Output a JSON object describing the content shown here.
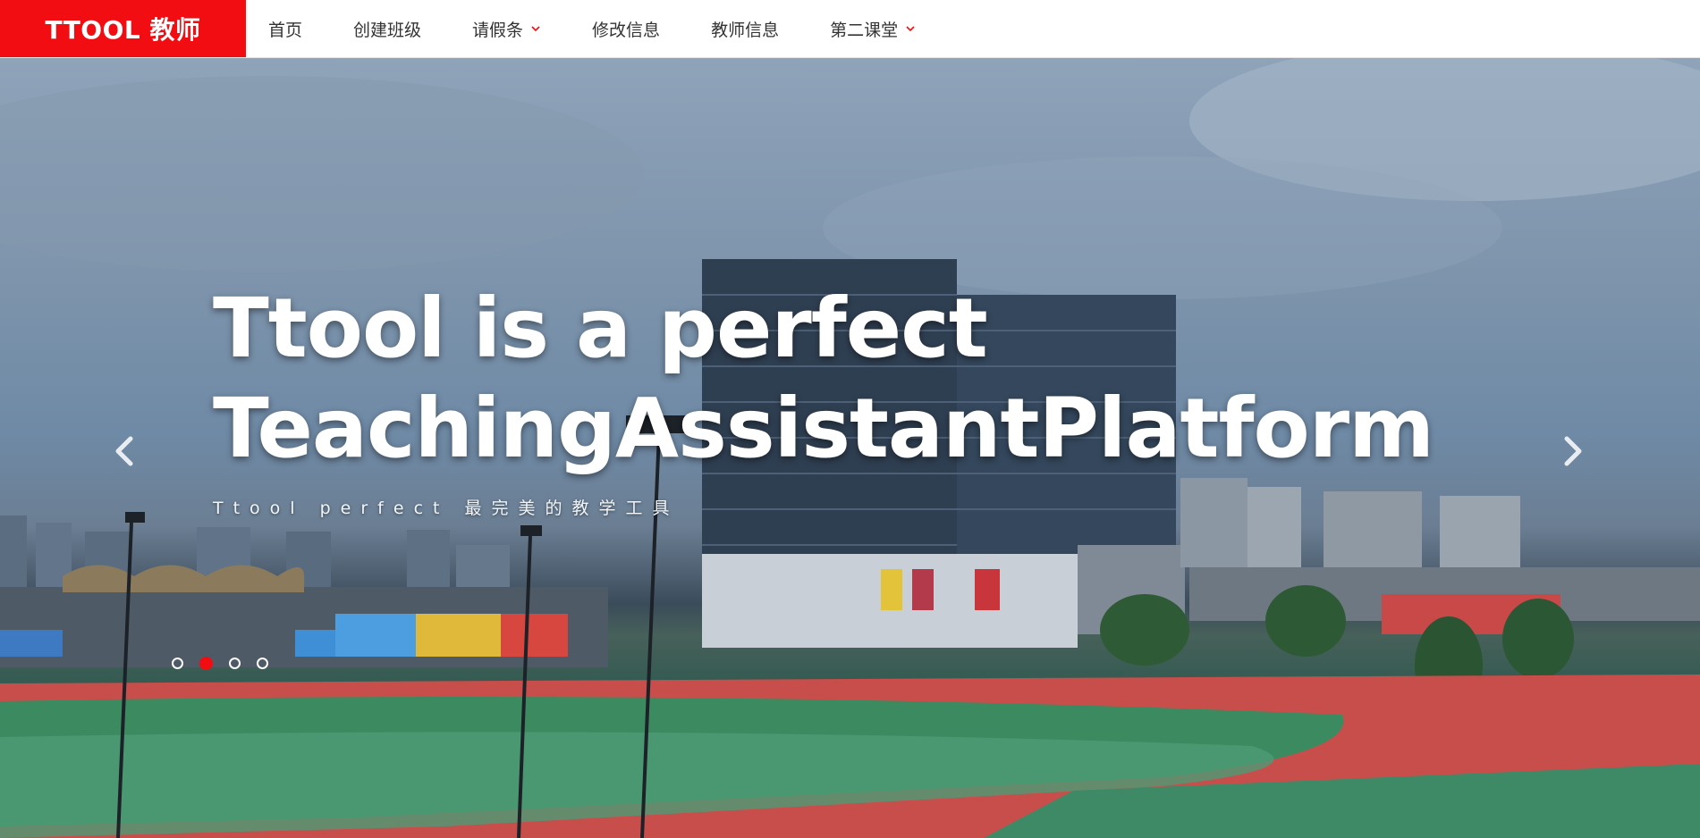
{
  "header": {
    "brand": "TTOOL 教师",
    "nav": [
      {
        "label": "首页",
        "has_dropdown": false
      },
      {
        "label": "创建班级",
        "has_dropdown": false
      },
      {
        "label": "请假条",
        "has_dropdown": true
      },
      {
        "label": "修改信息",
        "has_dropdown": false
      },
      {
        "label": "教师信息",
        "has_dropdown": false
      },
      {
        "label": "第二课堂",
        "has_dropdown": true
      }
    ]
  },
  "hero": {
    "title_line1": "Ttool is a perfect",
    "title_line2": "TeachingAssistantPlatform",
    "subtitle": "Ttool perfect 最完美的教学工具",
    "slides_total": 4,
    "active_slide": 2,
    "prev_icon": "chevron-left-icon",
    "next_icon": "chevron-right-icon"
  },
  "colors": {
    "accent": "#f20d12",
    "nav_text": "#333333",
    "hero_text": "#ffffff"
  }
}
